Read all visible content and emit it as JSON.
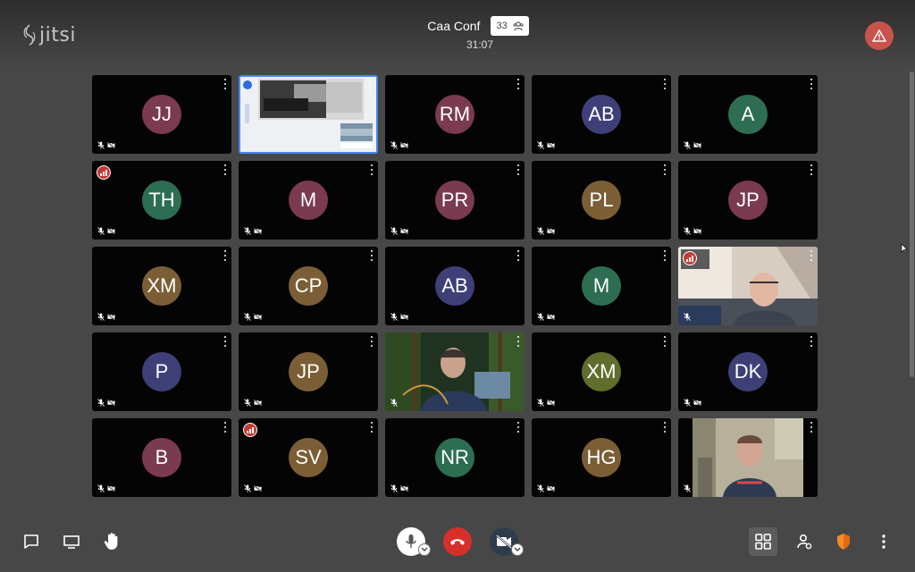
{
  "app": {
    "logo_text": "jitsi"
  },
  "conference": {
    "title": "Caa Conf",
    "participant_count": "33",
    "elapsed": "31:07"
  },
  "colors": {
    "accent": "#4687ed",
    "hangup": "#d72f2a",
    "warning": "#c9534c",
    "security": "#f28c28",
    "background": "#474747"
  },
  "tiles": [
    {
      "initials": "JJ",
      "color": "#7a3a4f",
      "type": "avatar"
    },
    {
      "initials": "",
      "color": "",
      "type": "screenshare"
    },
    {
      "initials": "RM",
      "color": "#7a3a4f",
      "type": "avatar"
    },
    {
      "initials": "AB",
      "color": "#3f3f78",
      "type": "avatar"
    },
    {
      "initials": "A",
      "color": "#2d6e52",
      "type": "avatar"
    },
    {
      "initials": "TH",
      "color": "#2d6e52",
      "type": "avatar",
      "badge": true
    },
    {
      "initials": "M",
      "color": "#7a3a4f",
      "type": "avatar"
    },
    {
      "initials": "PR",
      "color": "#7a3a4f",
      "type": "avatar"
    },
    {
      "initials": "PL",
      "color": "#7c5e36",
      "type": "avatar"
    },
    {
      "initials": "JP",
      "color": "#7a3a4f",
      "type": "avatar"
    },
    {
      "initials": "XM",
      "color": "#7c5e36",
      "type": "avatar"
    },
    {
      "initials": "CP",
      "color": "#7c5e36",
      "type": "avatar"
    },
    {
      "initials": "AB",
      "color": "#3f3f78",
      "type": "avatar"
    },
    {
      "initials": "M",
      "color": "#2d6e52",
      "type": "avatar"
    },
    {
      "initials": "",
      "color": "",
      "type": "video-room",
      "badge": true
    },
    {
      "initials": "P",
      "color": "#3f3f78",
      "type": "avatar"
    },
    {
      "initials": "JP",
      "color": "#7c5e36",
      "type": "avatar"
    },
    {
      "initials": "",
      "color": "",
      "type": "video-forest"
    },
    {
      "initials": "XM",
      "color": "#5f6e2d",
      "type": "avatar"
    },
    {
      "initials": "DK",
      "color": "#3f3f78",
      "type": "avatar"
    },
    {
      "initials": "B",
      "color": "#7a3a4f",
      "type": "avatar"
    },
    {
      "initials": "SV",
      "color": "#7c5e36",
      "type": "avatar",
      "badge": true
    },
    {
      "initials": "NR",
      "color": "#2d6e52",
      "type": "avatar"
    },
    {
      "initials": "HG",
      "color": "#7c5e36",
      "type": "avatar"
    },
    {
      "initials": "",
      "color": "",
      "type": "video-wall"
    }
  ],
  "toolbar": {
    "left": [
      "chat-icon",
      "screenshare-icon",
      "raise-hand-icon"
    ],
    "center": [
      "microphone-icon",
      "hangup-icon",
      "camera-off-icon"
    ],
    "right": [
      "tile-view-icon",
      "participants-icon",
      "security-shield-icon",
      "more-icon"
    ]
  }
}
